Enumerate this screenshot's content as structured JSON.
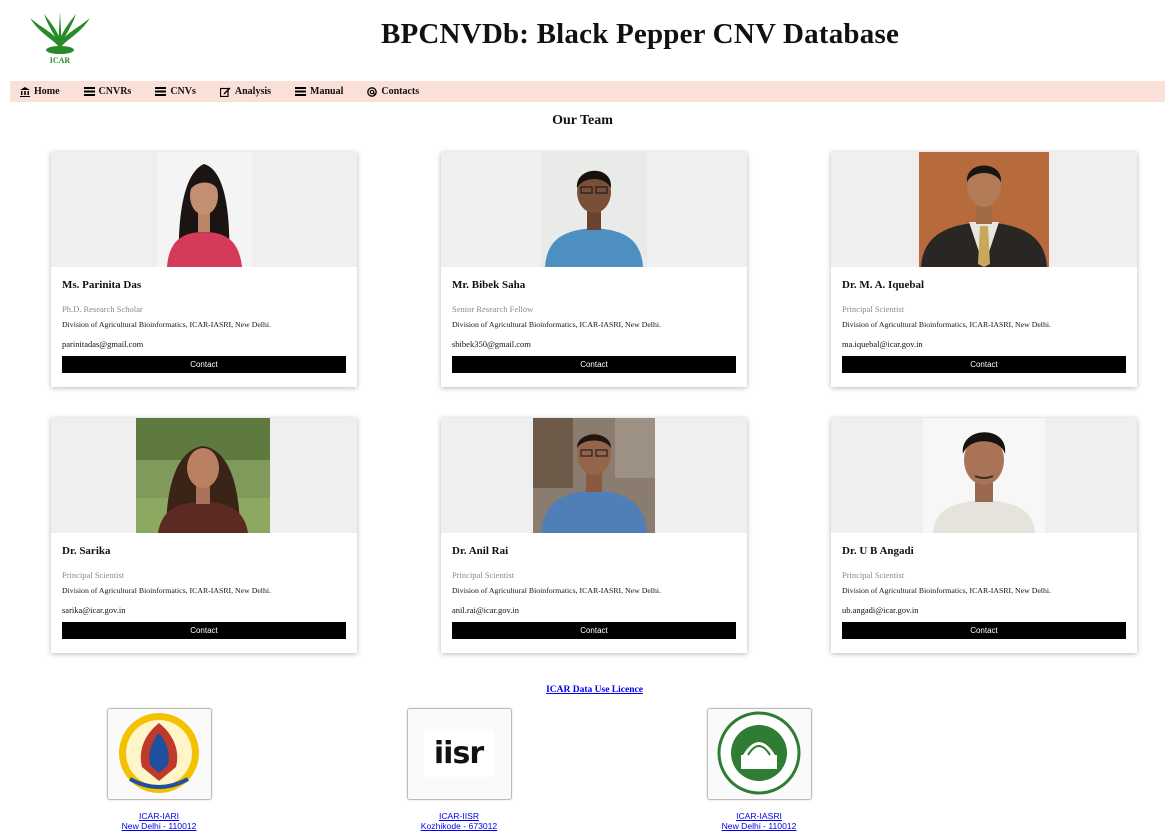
{
  "header": {
    "title": "BPCNVDb: Black Pepper CNV Database",
    "logo_text": "ICAR"
  },
  "nav": [
    {
      "label": "Home",
      "icon": "bank-icon"
    },
    {
      "label": "CNVRs",
      "icon": "list-icon"
    },
    {
      "label": "CNVs",
      "icon": "list-icon"
    },
    {
      "label": "Analysis",
      "icon": "edit-icon"
    },
    {
      "label": "Manual",
      "icon": "list-icon"
    },
    {
      "label": "Contacts",
      "icon": "at-icon"
    }
  ],
  "section_title": "Our Team",
  "team": [
    {
      "name": "Ms. Parinita Das",
      "role": "Ph.D. Research Scholar",
      "division": "Division of Agricultural Bioinformatics, ICAR-IASRI, New Delhi.",
      "email": "parinitadas@gmail.com",
      "button": "Contact"
    },
    {
      "name": "Mr. Bibek Saha",
      "role": "Senior Research Fellow",
      "division": "Division of Agricultural Bioinformatics, ICAR-IASRI, New Delhi.",
      "email": "sbibek350@gmail.com",
      "button": "Contact"
    },
    {
      "name": "Dr. M. A. Iquebal",
      "role": "Principal Scientist",
      "division": "Division of Agricultural Bioinformatics, ICAR-IASRI, New Delhi.",
      "email": "ma.iquebal@icar.gov.in",
      "button": "Contact"
    },
    {
      "name": "Dr. Sarika",
      "role": "Principal Scientist",
      "division": "Division of Agricultural Bioinformatics, ICAR-IASRI, New Delhi.",
      "email": "sarika@icar.gov.in",
      "button": "Contact"
    },
    {
      "name": "Dr. Anil Rai",
      "role": "Principal Scientist",
      "division": "Division of Agricultural Bioinformatics, ICAR-IASRI, New Delhi.",
      "email": "anil.rai@icar.gov.in",
      "button": "Contact"
    },
    {
      "name": "Dr. U B Angadi",
      "role": "Principal Scientist",
      "division": "Division of Agricultural Bioinformatics, ICAR-IASRI, New Delhi.",
      "email": "ub.angadi@icar.gov.in",
      "button": "Contact"
    }
  ],
  "footer": {
    "licence_link": "ICAR Data Use Licence",
    "institutes": [
      {
        "name": "ICAR-IARI",
        "location": "New Delhi - 110012"
      },
      {
        "name": "ICAR-IISR",
        "location": "Kozhikode - 673012",
        "logo_text": "iisr"
      },
      {
        "name": "ICAR-IASRI",
        "location": "New Delhi - 110012"
      }
    ]
  }
}
